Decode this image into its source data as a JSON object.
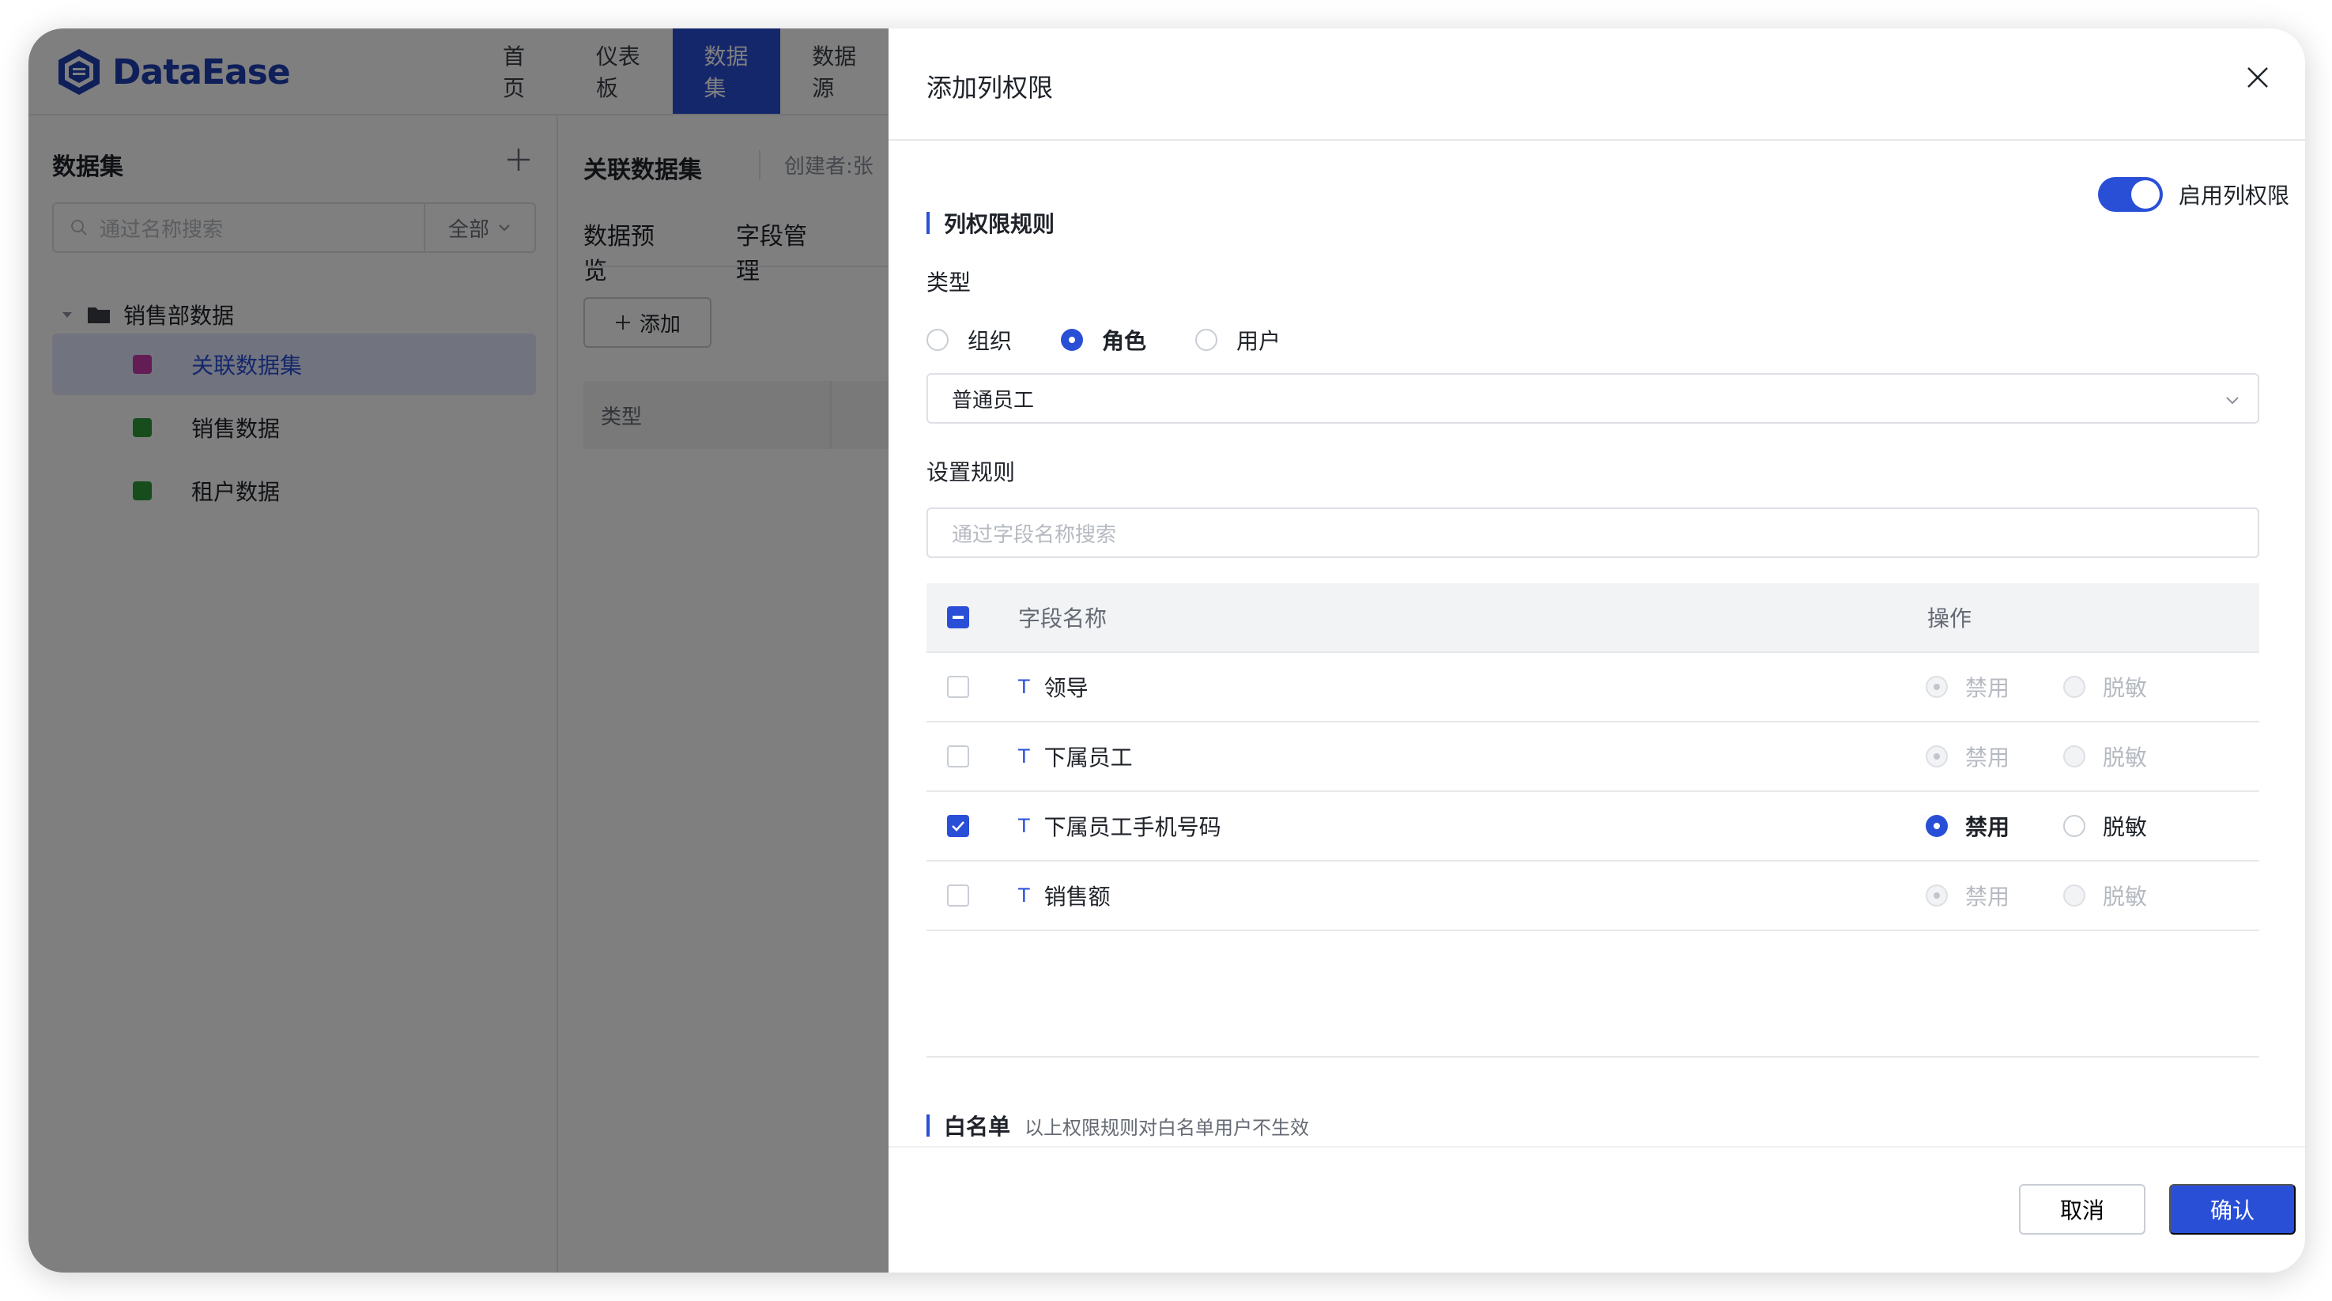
{
  "app": {
    "logo_text": "DataEase",
    "nav": [
      "首页",
      "仪表板",
      "数据集",
      "数据源"
    ],
    "active_nav": 2
  },
  "sidebar": {
    "title": "数据集",
    "search_placeholder": "通过名称搜索",
    "filter_label": "全部",
    "folder": "销售部数据",
    "items": [
      {
        "label": "关联数据集",
        "icon_color": "#c93aa8"
      },
      {
        "label": "销售数据",
        "icon_color": "#2f9a3b"
      },
      {
        "label": "租户数据",
        "icon_color": "#2f9a3b"
      }
    ]
  },
  "main": {
    "title": "关联数据集",
    "creator": "创建者:张",
    "tabs": [
      "数据预览",
      "字段管理"
    ],
    "add_button": "添加",
    "table_head_type": "类型"
  },
  "drawer": {
    "title": "添加列权限",
    "rule_section": "列权限规则",
    "enable_label": "启用列权限",
    "enabled": true,
    "type_label": "类型",
    "type_options": [
      "组织",
      "角色",
      "用户"
    ],
    "type_selected": 1,
    "select_value": "普通员工",
    "set_rules_label": "设置规则",
    "field_search_placeholder": "通过字段名称搜索",
    "table": {
      "col_name": "字段名称",
      "col_op": "操作",
      "op_disable": "禁用",
      "op_mask": "脱敏",
      "rows": [
        {
          "name": "领导",
          "checked": false
        },
        {
          "name": "下属员工",
          "checked": false
        },
        {
          "name": "下属员工手机号码",
          "checked": true
        },
        {
          "name": "销售额",
          "checked": false
        }
      ]
    },
    "whitelist_label": "白名单",
    "whitelist_hint": "以上权限规则对白名单用户不生效",
    "cancel_label": "取消",
    "confirm_label": "确认"
  },
  "colors": {
    "primary": "#2a4fd7",
    "brand": "#1f3fb5"
  }
}
